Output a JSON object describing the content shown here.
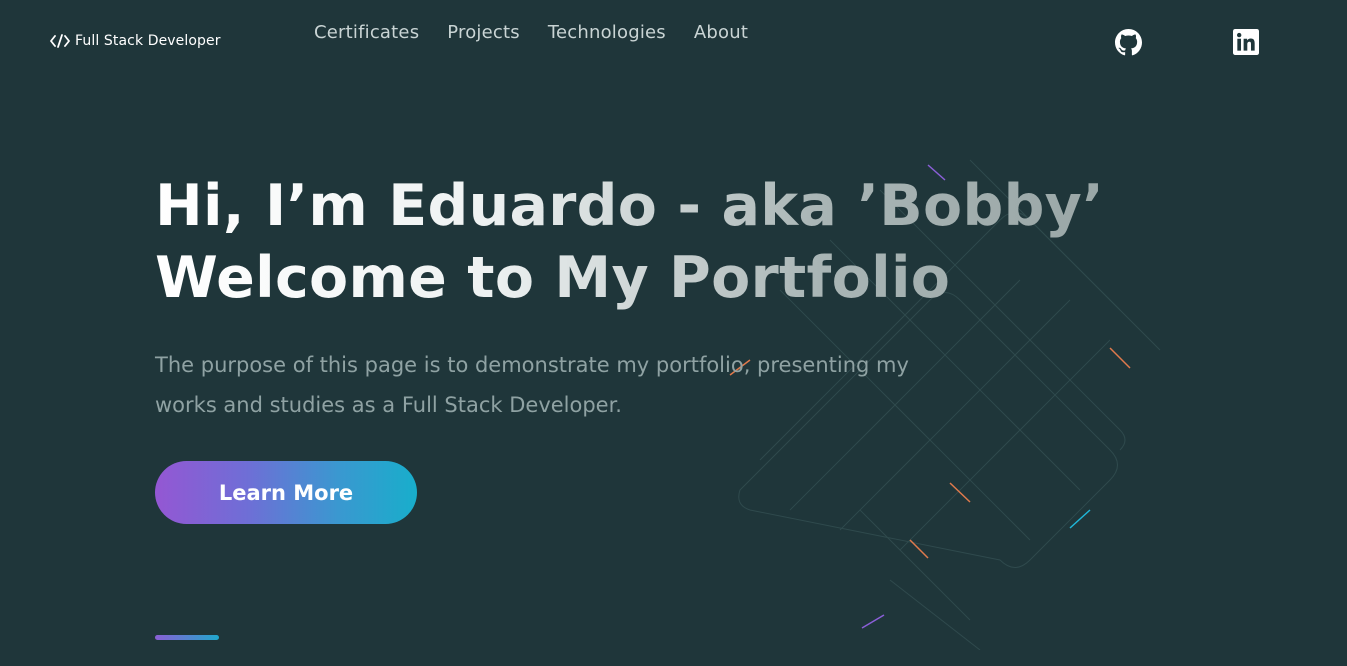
{
  "header": {
    "logo_text": "Full Stack Developer",
    "logo_icon": "code-brackets-icon",
    "nav": [
      {
        "label": "Certificates"
      },
      {
        "label": "Projects"
      },
      {
        "label": "Technologies"
      },
      {
        "label": "About"
      }
    ],
    "social": [
      {
        "icon": "github-icon"
      },
      {
        "icon": "linkedin-icon"
      }
    ]
  },
  "hero": {
    "headline_line1": "Hi, I’m Eduardo - aka ’Bobby’",
    "headline_line2": "Welcome to My Portfolio",
    "description": "The purpose of this page is to demonstrate my portfolio, presenting my works and studies as a Full Stack Developer.",
    "cta_label": "Learn More"
  },
  "colors": {
    "background": "#1f363a",
    "nav_text": "#c9d4d4",
    "description_text": "#8fa2a3",
    "gradient_start": "#9457d3",
    "gradient_end": "#18aecb"
  }
}
